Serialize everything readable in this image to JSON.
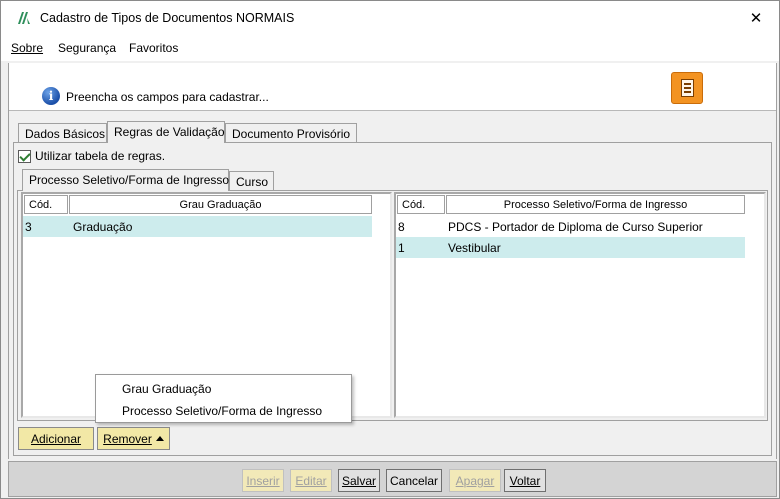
{
  "window": {
    "title": "Cadastro de Tipos de Documentos NORMAIS",
    "close_glyph": "✕"
  },
  "menu": [
    {
      "label": "Sobre"
    },
    {
      "label": "Segurança"
    },
    {
      "label": "Favoritos"
    }
  ],
  "info": {
    "message": "Preencha os campos para cadastrar..."
  },
  "tabs": [
    {
      "label": "Dados Básicos"
    },
    {
      "label": "Regras de Validação"
    },
    {
      "label": "Documento Provisório"
    }
  ],
  "use_rules": {
    "label": "Utilizar tabela de regras.",
    "checked": true
  },
  "subtabs": [
    {
      "label": "Processo Seletivo/Forma de Ingresso"
    },
    {
      "label": "Curso"
    }
  ],
  "left_table": {
    "headers": [
      "Cód.",
      "Grau Graduação"
    ],
    "rows": [
      {
        "cod": "3",
        "name": "Graduação",
        "selected": true
      }
    ]
  },
  "right_table": {
    "headers": [
      "Cód.",
      "Processo Seletivo/Forma de Ingresso"
    ],
    "rows": [
      {
        "cod": "8",
        "name": "PDCS - Portador de Diploma de Curso Superior",
        "selected": false
      },
      {
        "cod": "1",
        "name": "Vestibular",
        "selected": true
      }
    ]
  },
  "popup_menu": [
    {
      "label": "Grau Graduação"
    },
    {
      "label": "Processo Seletivo/Forma de Ingresso"
    }
  ],
  "actions": {
    "add": "Adicionar",
    "remove": "Remover"
  },
  "footer": {
    "insert": "Inserir",
    "edit": "Editar",
    "save": "Salvar",
    "cancel": "Cancelar",
    "delete": "Apagar",
    "back": "Voltar"
  },
  "colors": {
    "selection": "#cdeced",
    "yellow_button": "#f2e8a6",
    "doc_button": "#f39322"
  }
}
